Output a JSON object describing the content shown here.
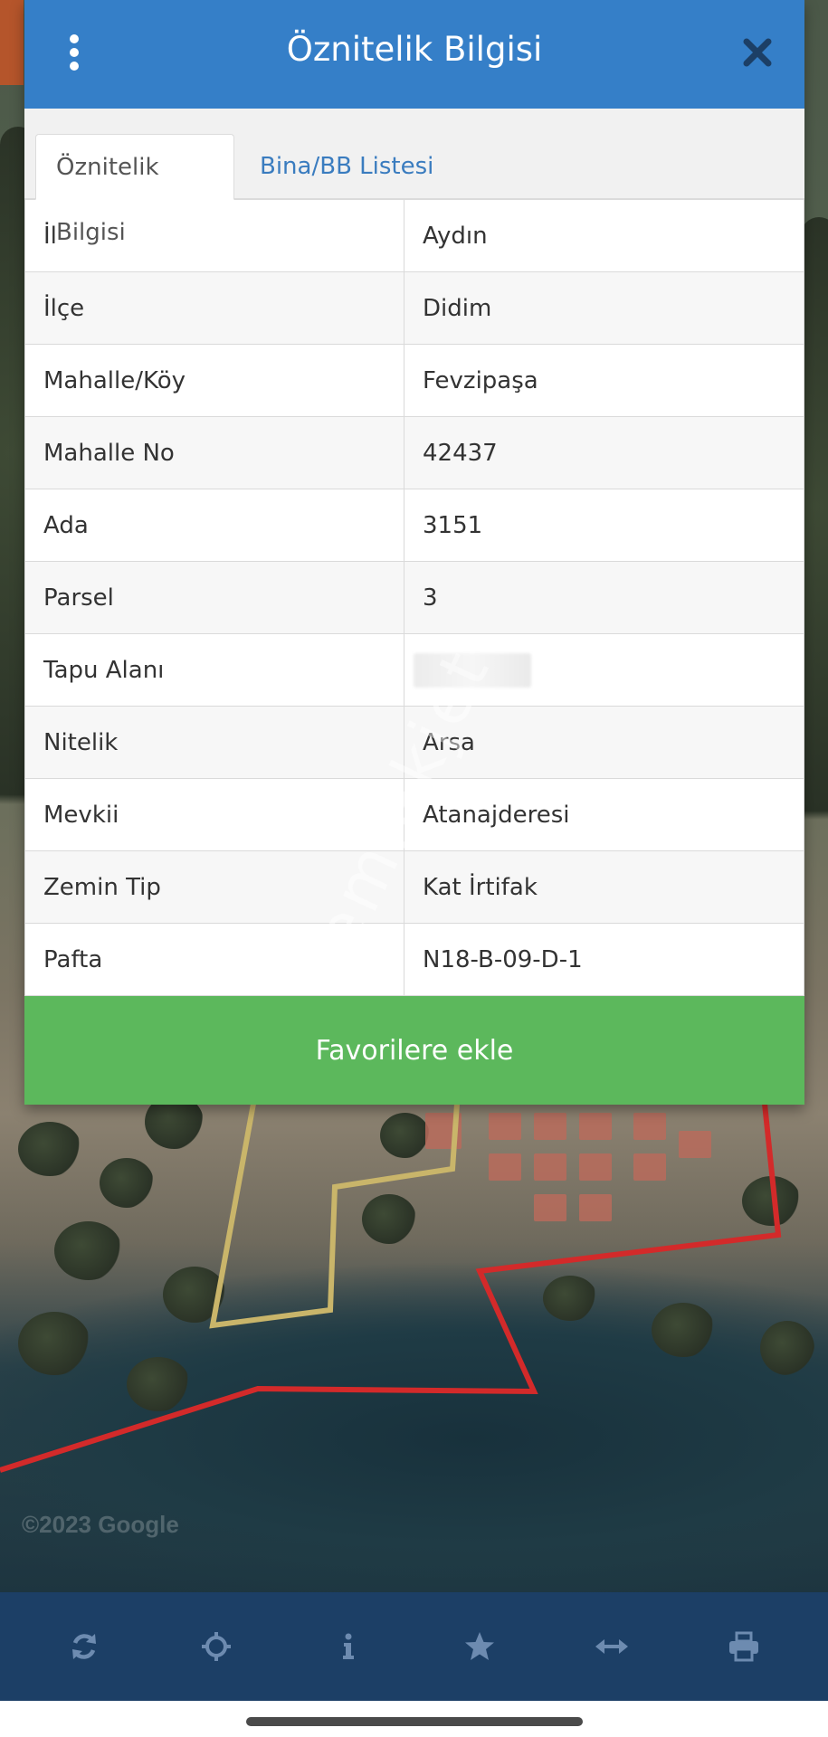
{
  "dialog": {
    "title": "Öznitelik Bilgisi",
    "tabs": [
      {
        "label": "Öznitelik Bilgisi",
        "active": true
      },
      {
        "label": "Bina/BB Listesi",
        "active": false
      }
    ],
    "rows": [
      {
        "key": "İl",
        "value": "Aydın"
      },
      {
        "key": "İlçe",
        "value": "Didim"
      },
      {
        "key": "Mahalle/Köy",
        "value": "Fevzipaşa"
      },
      {
        "key": "Mahalle No",
        "value": "42437"
      },
      {
        "key": "Ada",
        "value": "3151"
      },
      {
        "key": "Parsel",
        "value": "3"
      },
      {
        "key": "Tapu Alanı",
        "value": ""
      },
      {
        "key": "Nitelik",
        "value": "Arsa"
      },
      {
        "key": "Mevkii",
        "value": "Atanajderesi"
      },
      {
        "key": "Zemin Tip",
        "value": "Kat İrtifak"
      },
      {
        "key": "Pafta",
        "value": "N18-B-09-D-1"
      }
    ],
    "favorite_button_label": "Favorilere ekle"
  },
  "watermark": "emlakjet",
  "map_attribution": "©2023 Google",
  "toolbar": {
    "items": [
      "refresh-icon",
      "crosshair-icon",
      "info-icon",
      "star-icon",
      "measure-icon",
      "print-icon"
    ]
  },
  "colors": {
    "header": "#357fc8",
    "favorite_button": "#5cb85c",
    "toolbar": "#1c3f66",
    "tab_inactive_text": "#3a7cbf",
    "parcel_outline": "#c9b56a",
    "boundary_outline": "#d32a2a"
  }
}
